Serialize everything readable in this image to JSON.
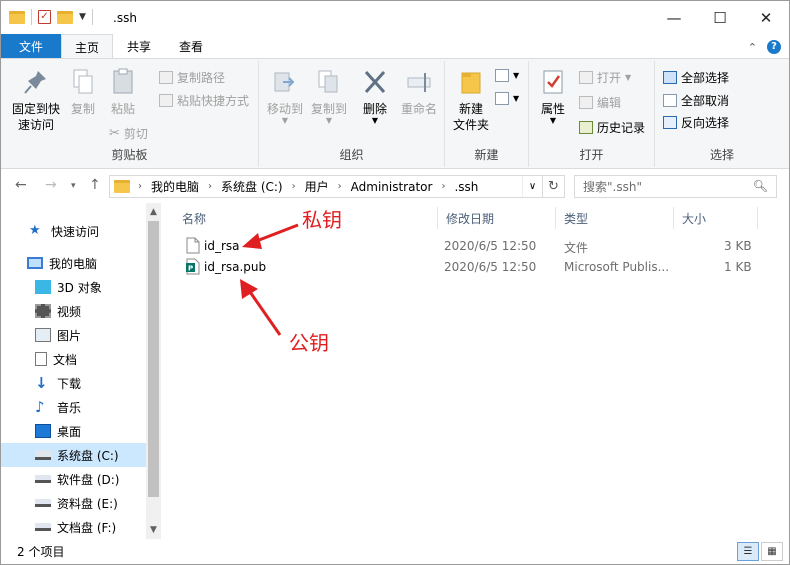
{
  "window": {
    "title": ".ssh",
    "minimize": "—",
    "maximize": "☐",
    "close": "✕"
  },
  "ribbon_tabs": [
    "文件",
    "主页",
    "共享",
    "查看"
  ],
  "ribbon": {
    "clipboard": {
      "label": "剪贴板",
      "pin": "固定到快\n速访问",
      "copy": "复制",
      "paste": "粘贴",
      "copy_path": "复制路径",
      "paste_shortcut": "粘贴快捷方式",
      "cut": "剪切"
    },
    "organize": {
      "label": "组织",
      "move_to": "移动到",
      "copy_to": "复制到",
      "delete": "删除",
      "rename": "重命名"
    },
    "new": {
      "label": "新建",
      "new_folder": "新建\n文件夹"
    },
    "open": {
      "label": "打开",
      "properties": "属性",
      "open": "打开",
      "edit": "编辑",
      "history": "历史记录"
    },
    "select": {
      "label": "选择",
      "select_all": "全部选择",
      "select_none": "全部取消",
      "invert": "反向选择"
    }
  },
  "address": {
    "crumbs": [
      "我的电脑",
      "系统盘 (C:)",
      "用户",
      "Administrator",
      ".ssh"
    ],
    "search_placeholder": "搜索\".ssh\""
  },
  "nav_pane": {
    "items": [
      {
        "label": "快速访问",
        "icon": "star-icon"
      },
      {
        "label": "我的电脑",
        "icon": "computer-icon"
      },
      {
        "label": "3D 对象",
        "icon": "cube-icon"
      },
      {
        "label": "视频",
        "icon": "video-icon"
      },
      {
        "label": "图片",
        "icon": "picture-icon"
      },
      {
        "label": "文档",
        "icon": "document-icon"
      },
      {
        "label": "下载",
        "icon": "download-icon"
      },
      {
        "label": "音乐",
        "icon": "music-icon"
      },
      {
        "label": "桌面",
        "icon": "desktop-icon"
      },
      {
        "label": "系统盘 (C:)",
        "icon": "drive-icon"
      },
      {
        "label": "软件盘 (D:)",
        "icon": "drive-icon"
      },
      {
        "label": "资料盘 (E:)",
        "icon": "drive-icon"
      },
      {
        "label": "文档盘 (F:)",
        "icon": "drive-icon"
      }
    ],
    "selected": "系统盘 (C:)"
  },
  "columns": [
    "名称",
    "修改日期",
    "类型",
    "大小"
  ],
  "files": [
    {
      "name": "id_rsa",
      "modified": "2020/6/5 12:50",
      "type": "文件",
      "size": "3 KB",
      "icon": "file-icon"
    },
    {
      "name": "id_rsa.pub",
      "modified": "2020/6/5 12:50",
      "type": "Microsoft Publis...",
      "size": "1 KB",
      "icon": "publisher-file-icon"
    }
  ],
  "annotations": {
    "private_key": "私钥",
    "public_key": "公钥"
  },
  "status": {
    "count": "2 个项目"
  },
  "colors": {
    "accent": "#1979ca",
    "annotation": "#e02020",
    "selected": "#cce8ff"
  }
}
